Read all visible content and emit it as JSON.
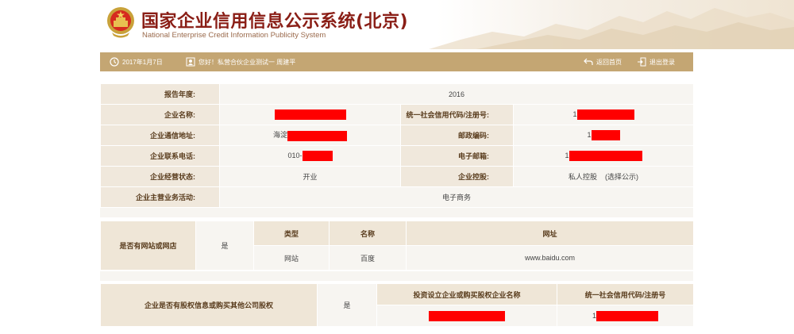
{
  "header": {
    "title": "国家企业信用信息公示系统(北京)",
    "subtitle": "National Enterprise Credit Information Publicity System"
  },
  "navbar": {
    "date": "2017年1月7日",
    "greeting": "您好！私营合伙企业测试一 周建平",
    "home_label": "返回首页",
    "logout_label": "退出登录"
  },
  "report": {
    "year_label": "报告年度:",
    "year_value": "2016",
    "name_label": "企业名称:",
    "credit_code_label": "统一社会信用代码/注册号:",
    "credit_code_prefix": "1",
    "address_label": "企业通信地址:",
    "address_prefix": "海淀",
    "postcode_label": "邮政编码:",
    "postcode_prefix": "1",
    "phone_label": "企业联系电话:",
    "phone_prefix": "010-",
    "email_label": "电子邮箱:",
    "email_prefix": "1",
    "status_label": "企业经营状态:",
    "status_value": "开业",
    "holding_label": "企业控股:",
    "holding_value": "私人控股",
    "holding_note": "(选择公示)",
    "business_label": "企业主营业务活动:",
    "business_value": "电子商务"
  },
  "website": {
    "question": "是否有网站或网店",
    "answer": "是",
    "columns": [
      "类型",
      "名称",
      "网址"
    ],
    "rows": [
      {
        "type": "网站",
        "name": "百度",
        "url": "www.baidu.com"
      }
    ]
  },
  "equity": {
    "question": "企业是否有股权信息或购买其他公司股权",
    "answer": "是",
    "columns": [
      "投资设立企业或购买股权企业名称",
      "统一社会信用代码/注册号"
    ],
    "row_code_prefix": "1"
  },
  "colors": {
    "navbar": "#c4a673",
    "label_bg": "#f0e8dc",
    "value_bg": "#f7f5f1",
    "title_red": "#8a1e16",
    "redaction": "#ff0000"
  }
}
